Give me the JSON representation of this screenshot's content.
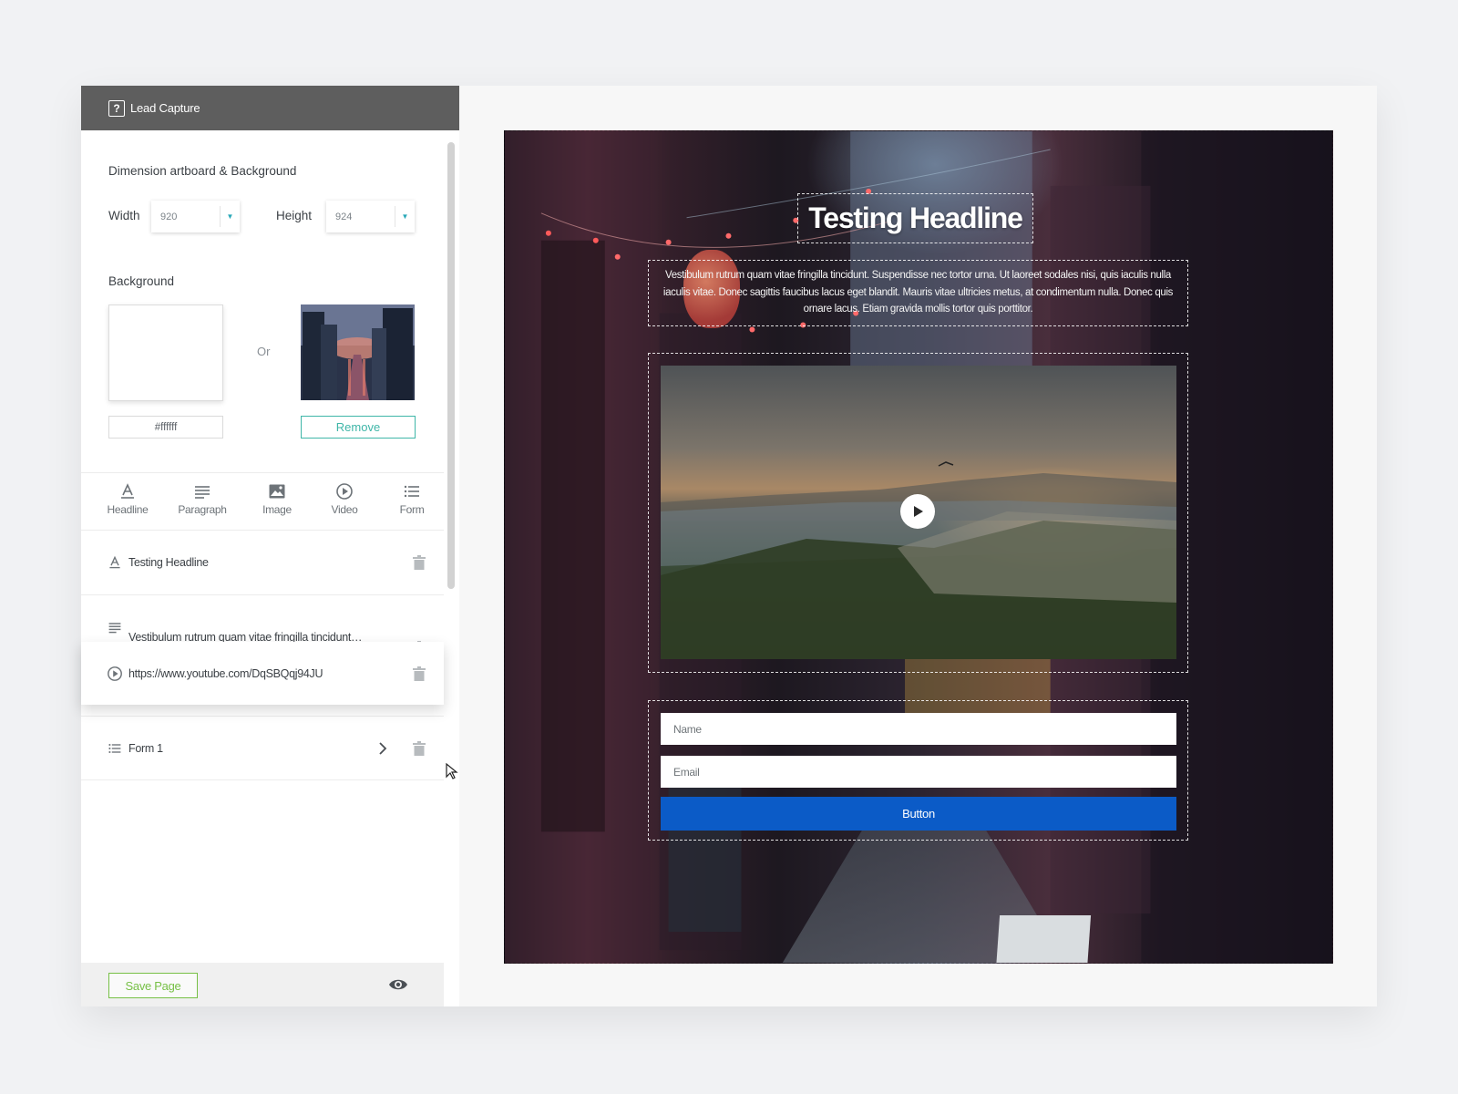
{
  "header": {
    "title": "Lead Capture"
  },
  "dimension": {
    "title": "Dimension artboard & Background",
    "width_label": "Width",
    "width_value": "920",
    "height_label": "Height",
    "height_value": "924"
  },
  "background": {
    "label": "Background",
    "or_text": "Or",
    "hex_value": "#ffffff",
    "remove_label": "Remove"
  },
  "tools": [
    {
      "label": "Headline",
      "icon": "headline-icon"
    },
    {
      "label": "Paragraph",
      "icon": "paragraph-icon"
    },
    {
      "label": "Image",
      "icon": "image-icon"
    },
    {
      "label": "Video",
      "icon": "video-icon"
    },
    {
      "label": "Form",
      "icon": "form-icon"
    }
  ],
  "layers": [
    {
      "label": "Testing Headline",
      "icon": "headline-icon"
    },
    {
      "label": "Vestibulum rutrum quam vitae fringilla tincidunt…",
      "icon": "paragraph-icon"
    },
    {
      "label": "https://www.youtube.com/DqSBQqj94JU",
      "icon": "video-icon"
    },
    {
      "label": "Form 1",
      "icon": "form-icon"
    }
  ],
  "footer": {
    "save_label": "Save Page"
  },
  "canvas": {
    "headline": "Testing Headline",
    "paragraph": "Vestibulum rutrum quam vitae fringilla tincidunt. Suspendisse nec tortor urna. Ut laoreet sodales nisi, quis iaculis nulla iaculis vitae. Donec sagittis faucibus lacus eget blandit. Mauris vitae ultricies metus, at condimentum nulla. Donec quis ornare lacus. Etiam gravida mollis tortor quis porttitor.",
    "form": {
      "name_placeholder": "Name",
      "email_placeholder": "Email",
      "button_label": "Button"
    }
  },
  "colors": {
    "accent_teal": "#3fb6a8",
    "save_green": "#77c046",
    "form_button_blue": "#0b5bc7",
    "header_gray": "#5e5e5e"
  }
}
